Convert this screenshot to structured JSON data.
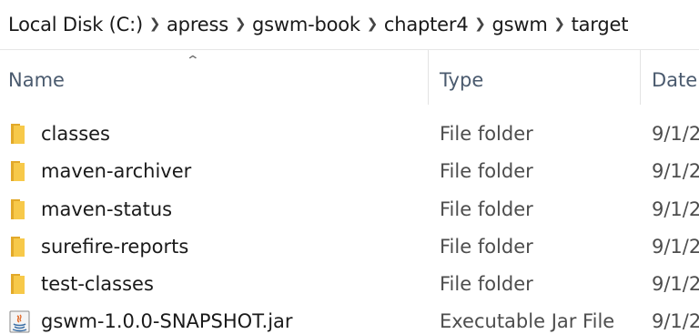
{
  "breadcrumb": {
    "items": [
      "Local Disk (C:)",
      "apress",
      "gswm-book",
      "chapter4",
      "gswm",
      "target"
    ]
  },
  "columns": {
    "name": "Name",
    "type": "Type",
    "date": "Date"
  },
  "files": [
    {
      "name": "classes",
      "type": "File folder",
      "date": "9/1/2",
      "icon": "folder-icon"
    },
    {
      "name": "maven-archiver",
      "type": "File folder",
      "date": "9/1/2",
      "icon": "folder-icon"
    },
    {
      "name": "maven-status",
      "type": "File folder",
      "date": "9/1/2",
      "icon": "folder-icon"
    },
    {
      "name": "surefire-reports",
      "type": "File folder",
      "date": "9/1/2",
      "icon": "folder-icon"
    },
    {
      "name": "test-classes",
      "type": "File folder",
      "date": "9/1/2",
      "icon": "folder-icon"
    },
    {
      "name": "gswm-1.0.0-SNAPSHOT.jar",
      "type": "Executable Jar File",
      "date": "9/1/2",
      "icon": "java-jar-icon"
    }
  ],
  "colors": {
    "folder": "#f7c94a",
    "folder_dark": "#e2a92a",
    "header_text": "#4a5a6e",
    "divider": "#e3e3e3"
  }
}
